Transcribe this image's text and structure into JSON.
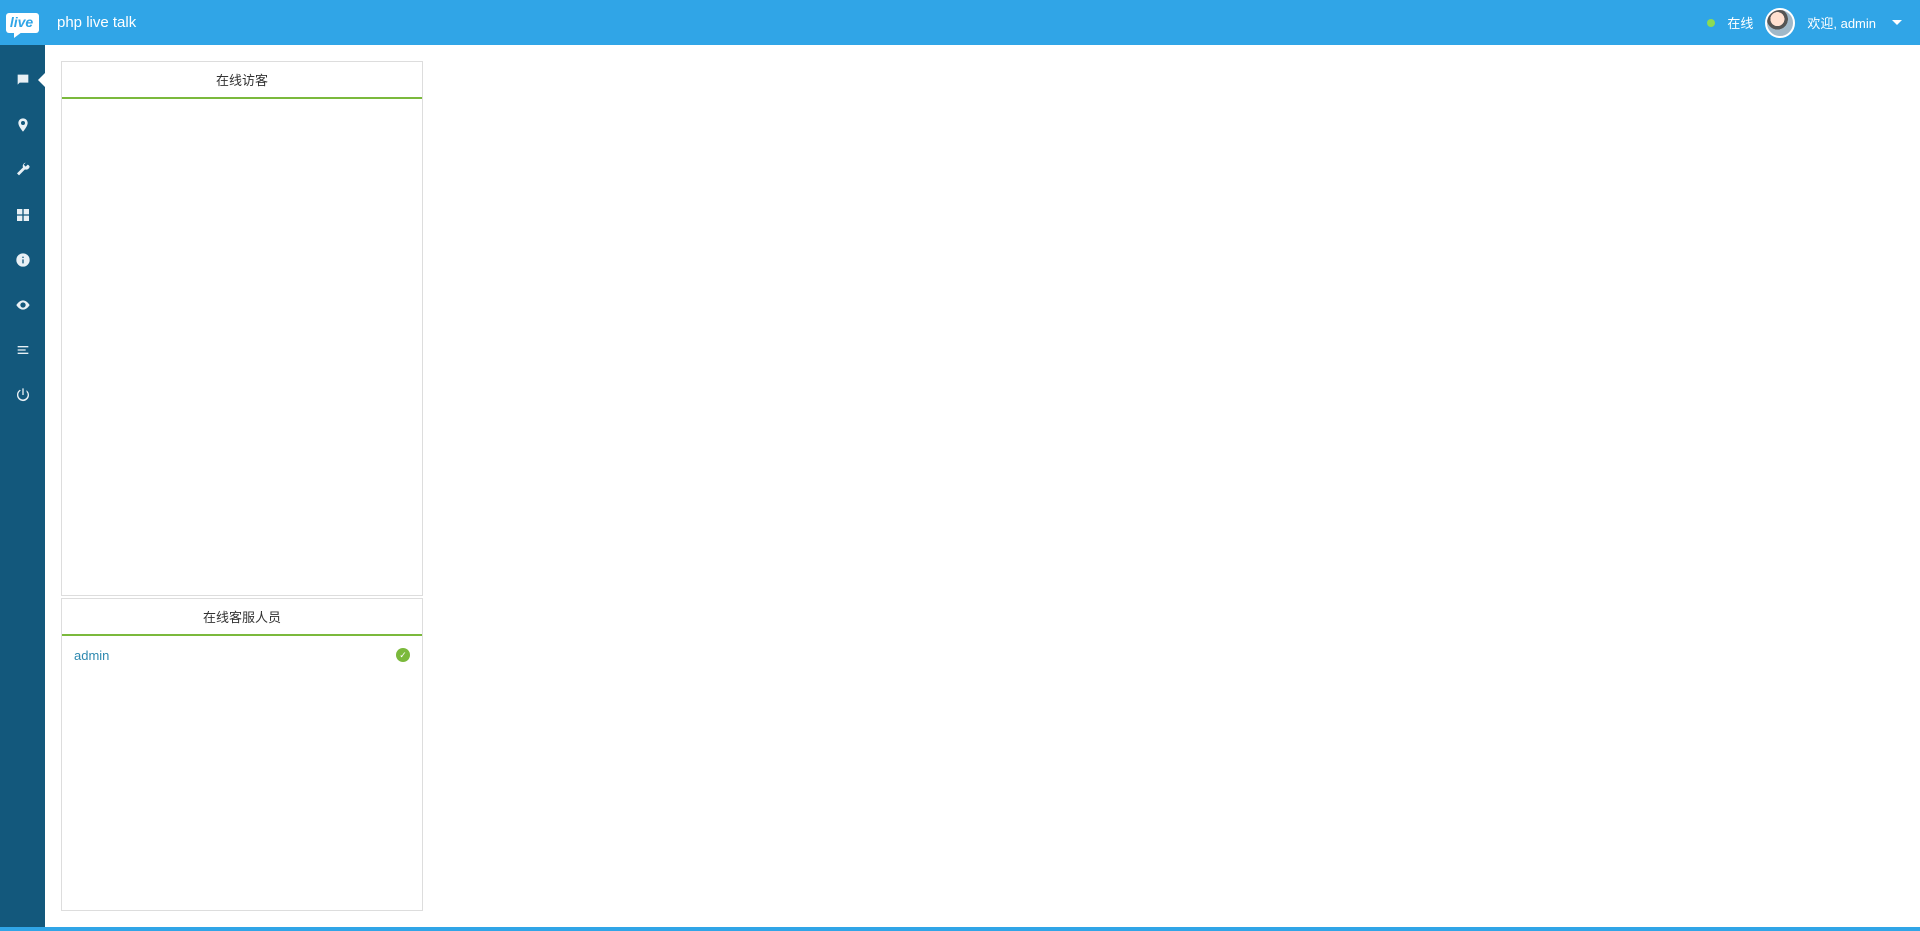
{
  "header": {
    "logo_text": "live",
    "app_title": "php live talk",
    "status_label": "在线",
    "welcome_text": "欢迎, admin"
  },
  "sidebar": {
    "items": [
      {
        "name": "chat",
        "active": true
      },
      {
        "name": "location",
        "active": false
      },
      {
        "name": "settings",
        "active": false
      },
      {
        "name": "widgets",
        "active": false
      },
      {
        "name": "info",
        "active": false
      },
      {
        "name": "view",
        "active": false
      },
      {
        "name": "list",
        "active": false
      },
      {
        "name": "power",
        "active": false
      }
    ]
  },
  "panels": {
    "visitors_title": "在线访客",
    "agents_title": "在线客服人员",
    "agents": [
      {
        "name": "admin",
        "online": true
      }
    ]
  }
}
